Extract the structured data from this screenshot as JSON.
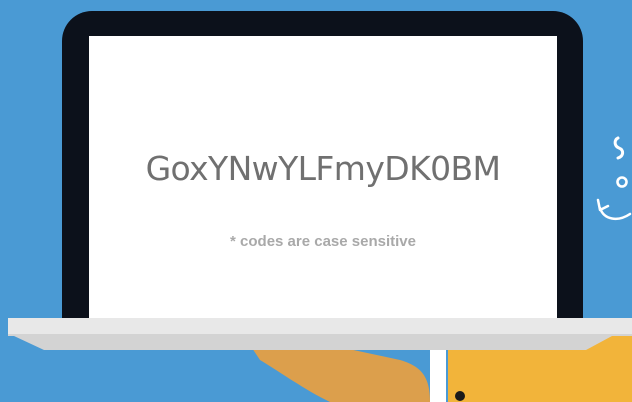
{
  "screen": {
    "code": "GoxYNwYLFmyDK0BM",
    "note": "* codes are case sensitive"
  },
  "colors": {
    "background": "#4a9ad4",
    "bezel": "#0c111b",
    "screen": "#ffffff",
    "code_text": "#707070",
    "note_text": "#a9a9a9",
    "base_top": "#e8e8e8",
    "base_bottom": "#d3d3d3",
    "hand": "#dc9f4c",
    "sleeve": "#f2b43a"
  },
  "icons": {
    "doodle": "curved-arrow-icon"
  }
}
